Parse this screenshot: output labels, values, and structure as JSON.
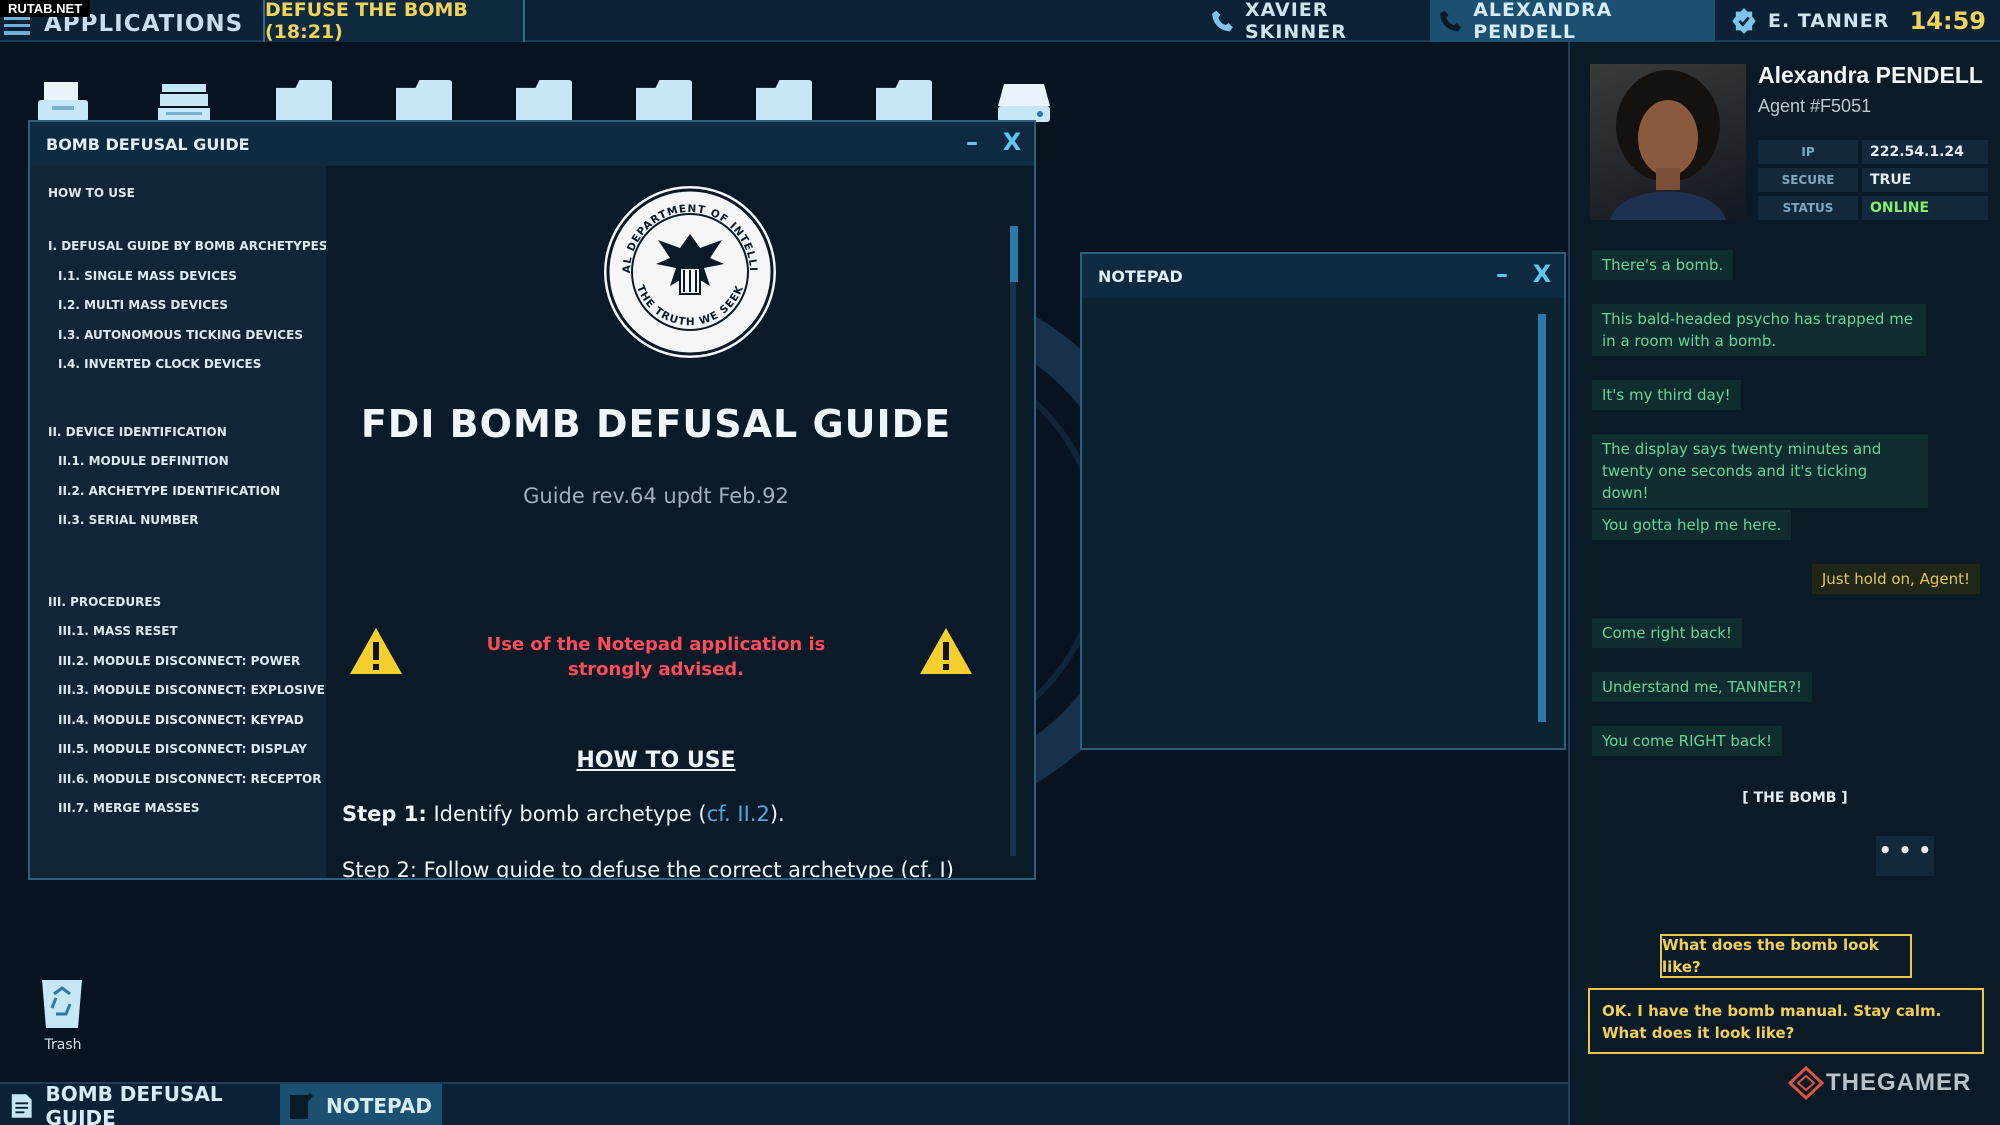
{
  "watermark": "RUTAB.NET",
  "topbar": {
    "apps_label": "APPLICATIONS",
    "mission": "DEFUSE THE BOMB (18:21)",
    "contacts": [
      "XAVIER SKINNER",
      "ALEXANDRA PENDELL",
      "E. TANNER"
    ],
    "clock": "14:59"
  },
  "guide": {
    "window_title": "BOMB DEFUSAL GUIDE",
    "toc": [
      "HOW TO USE",
      "I. DEFUSAL GUIDE BY BOMB ARCHETYPES",
      "I.1. SINGLE MASS DEVICES",
      "I.2. MULTI MASS DEVICES",
      "I.3. AUTONOMOUS TICKING DEVICES",
      "I.4. INVERTED CLOCK DEVICES",
      "II. DEVICE IDENTIFICATION",
      "II.1. MODULE DEFINITION",
      "II.2. ARCHETYPE IDENTIFICATION",
      "II.3. SERIAL NUMBER",
      "III. PROCEDURES",
      "III.1. MASS RESET",
      "III.2. MODULE DISCONNECT: POWER",
      "III.3. MODULE DISCONNECT: EXPLOSIVE",
      "III.4. MODULE DISCONNECT: KEYPAD",
      "III.5. MODULE DISCONNECT: DISPLAY",
      "III.6. MODULE DISCONNECT: RECEPTOR",
      "III.7. MERGE MASSES"
    ],
    "seal_top_text": "FEDERAL DEPARTMENT OF INTELLIGENCE",
    "seal_bottom_text": "THE TRUTH WE SEEK",
    "title": "FDI BOMB DEFUSAL GUIDE",
    "revision": "Guide rev.64 updt Feb.92",
    "warning": "Use of the Notepad application is strongly advised.",
    "howto_heading": "HOW TO USE",
    "step1_label": "Step 1:",
    "step1_text": " Identify bomb archetype (",
    "step1_ref": "cf. II.2",
    "step1_end": ").",
    "step2_text": "Step 2: Follow guide to defuse the correct archetype (cf. I)"
  },
  "notepad": {
    "window_title": "NOTEPAD",
    "content": ""
  },
  "window_controls": {
    "minimize": "–",
    "close": "X"
  },
  "desktop": {
    "trash_label": "Trash"
  },
  "taskbar": {
    "items": [
      "BOMB DEFUSAL GUIDE",
      "NOTEPAD"
    ]
  },
  "agent": {
    "name": "Alexandra PENDELL",
    "id": "Agent #F5051",
    "info": [
      {
        "key": "IP",
        "value": "222.54.1.24"
      },
      {
        "key": "SECURE",
        "value": "TRUE"
      },
      {
        "key": "STATUS",
        "value": "ONLINE"
      }
    ]
  },
  "chat": {
    "messages": [
      {
        "from": "agent",
        "text": "There's a bomb."
      },
      {
        "from": "agent",
        "text": "This bald-headed psycho has trapped me in a room with a bomb."
      },
      {
        "from": "agent",
        "text": "It's my third day!"
      },
      {
        "from": "agent",
        "text": "The display says twenty minutes and twenty one seconds and it's ticking down!"
      },
      {
        "from": "agent",
        "text": "You gotta help me here."
      },
      {
        "from": "me",
        "text": "Just hold on, Agent!"
      },
      {
        "from": "agent",
        "text": "Come right back!"
      },
      {
        "from": "agent",
        "text": "Understand me, TANNER?!"
      },
      {
        "from": "agent",
        "text": "You come RIGHT back!"
      }
    ],
    "event": "[ THE BOMB ]",
    "typing": "• • •",
    "choices": [
      "What does the bomb look like?",
      "OK. I have the bomb manual. Stay calm. What does it look like?"
    ]
  },
  "branding": {
    "logo_text": "THEGAMER"
  },
  "colors": {
    "accent": "#2b7aa8",
    "warning": "#ff4b5a",
    "highlight": "#f2d35a",
    "online": "#86f06a"
  }
}
